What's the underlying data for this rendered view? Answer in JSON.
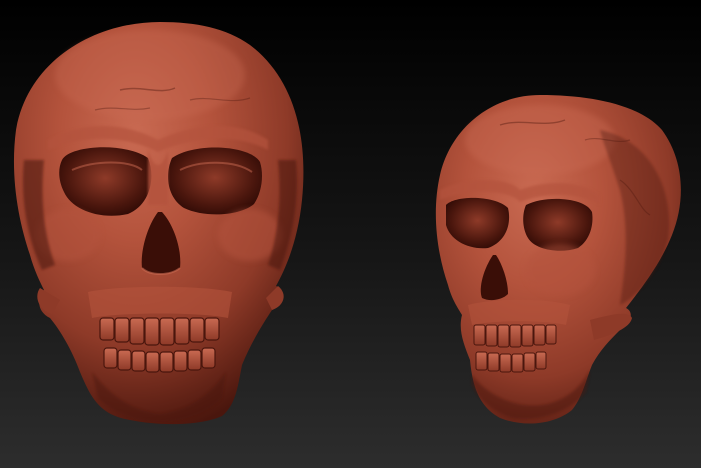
{
  "scene": {
    "models": [
      {
        "name": "skull-front",
        "view": "front"
      },
      {
        "name": "skull-three-quarter",
        "view": "three-quarter"
      }
    ],
    "colors": {
      "background_top": "#000000",
      "background_mid": "#161616",
      "background_bottom": "#2d2d2d",
      "clay_base": "#8e3a28",
      "clay_highlight": "#b4533c",
      "clay_light": "#c96a52",
      "clay_shadow": "#4a160d",
      "clay_deep": "#2e0a05"
    }
  }
}
